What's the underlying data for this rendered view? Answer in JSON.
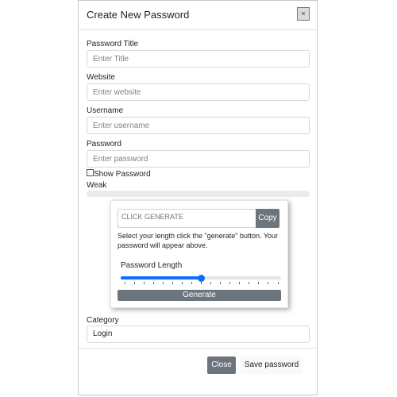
{
  "modal": {
    "title": "Create New Password",
    "close_icon_glyph": "×"
  },
  "fields": {
    "title": {
      "label": "Password Title",
      "placeholder": "Enter Title"
    },
    "website": {
      "label": "Website",
      "placeholder": "Enter website"
    },
    "username": {
      "label": "Username",
      "placeholder": "Enter username"
    },
    "password": {
      "label": "Password",
      "placeholder": "Enter password"
    }
  },
  "show_password": {
    "label": "Show Password",
    "checked": false
  },
  "strength": {
    "label": "Weak",
    "value": 0
  },
  "generator": {
    "output_placeholder": "CLICK GENERATE",
    "copy_label": "Copy",
    "help_text": "Select your length click the \"generate\" button. Your password will appear above.",
    "length_label": "Password Length",
    "slider_value": 0.5,
    "generate_label": "Generate"
  },
  "category": {
    "label": "Category",
    "value": "Login"
  },
  "footer": {
    "close_label": "Close",
    "save_label": "Save password"
  },
  "colors": {
    "primary": "#0d6efd",
    "secondary": "#6c757d",
    "light": "#f8f9fa"
  },
  "icons": {
    "close": "close-icon"
  }
}
